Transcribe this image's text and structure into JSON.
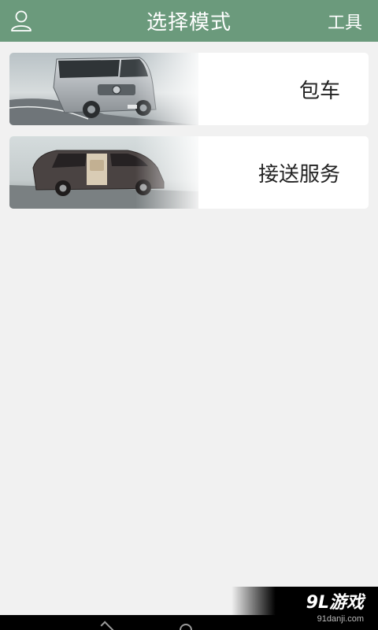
{
  "header": {
    "title": "选择模式",
    "tools_label": "工具",
    "user_icon": "user-icon",
    "bg_color": "#6b9a7c"
  },
  "modes": [
    {
      "label": "包车",
      "image": "van-image"
    },
    {
      "label": "接送服务",
      "image": "minivan-image"
    }
  ],
  "watermark": {
    "brand": "9L游戏",
    "site": "91danji.com"
  },
  "navbar": {
    "back_icon": "back-icon",
    "home_icon": "home-icon"
  }
}
